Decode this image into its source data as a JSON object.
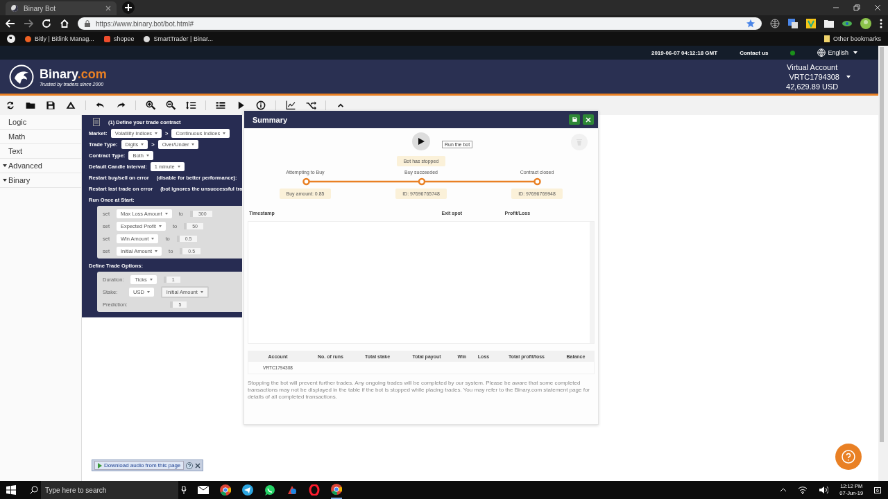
{
  "browser": {
    "tab_title": "Binary Bot",
    "url": "https://www.binary.bot/bot.html#",
    "bookmarks": [
      "Bitly | Bitlink Manag...",
      "shopee",
      "SmartTrader | Binar..."
    ],
    "other_bookmarks": "Other bookmarks"
  },
  "site_bar": {
    "datetime": "2019-06-07 04:12:18 GMT",
    "contact": "Contact us",
    "online": true,
    "language": "English"
  },
  "header": {
    "logo_name": "Binary",
    "logo_suffix": ".com",
    "tagline": "Trusted by traders since 2000",
    "account_type": "Virtual Account",
    "account_id": "VRTC1794308",
    "balance": "42,629.89 USD"
  },
  "toolbox": [
    {
      "label": "Logic",
      "expandable": false
    },
    {
      "label": "Math",
      "expandable": false
    },
    {
      "label": "Text",
      "expandable": false
    },
    {
      "label": "Advanced",
      "expandable": true
    },
    {
      "label": "Binary",
      "expandable": true
    }
  ],
  "block": {
    "title": "(1) Define your trade contract",
    "separator": ">",
    "rows": [
      {
        "kind": "dropdowns",
        "label": "Market:",
        "dropdowns": [
          "Volatility Indices",
          "Continuous Indices"
        ]
      },
      {
        "kind": "dropdowns",
        "label": "Trade Type:",
        "dropdowns": [
          "Digits",
          "Over/Under"
        ]
      },
      {
        "kind": "dropdowns",
        "label": "Contract Type:",
        "dropdowns": [
          "Both"
        ]
      },
      {
        "kind": "dropdowns",
        "label": "Default Candle Interval:",
        "dropdowns": [
          "1 minute"
        ]
      },
      {
        "kind": "note",
        "label": "Restart buy/sell on error",
        "note": "(disable for better performance):"
      },
      {
        "kind": "note",
        "label": "Restart last trade on error",
        "note": "(bot ignores the unsuccessful tra"
      }
    ],
    "run_once_label": "Run Once at Start:",
    "set_rows": [
      {
        "keyword": "set",
        "variable": "Max Loss Amount",
        "connector": "to",
        "value": "300"
      },
      {
        "keyword": "set",
        "variable": "Expected Profit",
        "connector": "to",
        "value": "50"
      },
      {
        "keyword": "set",
        "variable": "Win Amount",
        "connector": "to",
        "value": "0.5"
      },
      {
        "keyword": "set",
        "variable": "Initial Amount",
        "connector": "to",
        "value": "0.5"
      }
    ],
    "trade_options_label": "Define Trade Options:",
    "options": [
      {
        "kind": "duration",
        "label": "Duration:",
        "dropdown": "Ticks",
        "value": "1"
      },
      {
        "kind": "stake",
        "label": "Stake:",
        "dropdown": "USD",
        "value_dropdown": "Initial Amount"
      },
      {
        "kind": "prediction",
        "label": "Prediction:",
        "value": "5"
      }
    ]
  },
  "summary": {
    "title": "Summary",
    "tooltip": "Run the bot",
    "status": "Bot has stopped",
    "steps": [
      {
        "label": "Attempting to Buy",
        "detail": "Buy amount: 0.85"
      },
      {
        "label": "Buy succeeded",
        "detail": "ID: 97696765748"
      },
      {
        "label": "Contract closed",
        "detail": "ID: 97696769948"
      }
    ],
    "columns": [
      "Timestamp",
      "Exit spot",
      "Profit/Loss"
    ],
    "stats_columns": [
      "Account",
      "No. of runs",
      "Total stake",
      "Total payout",
      "Win",
      "Loss",
      "Total profit/loss",
      "Balance"
    ],
    "stats_row": [
      "VRTC1794308"
    ],
    "notice": "Stopping the bot will prevent further trades. Any ongoing trades will be completed by our system. Please be aware that some completed transactions may not be displayed in the table if the bot is stopped while placing trades. You may refer to the Binary.com statement page for details of all completed transactions."
  },
  "download_bar": {
    "label": "Download audio from this page"
  },
  "taskbar": {
    "search_placeholder": "Type here to search",
    "time": "12:12 PM",
    "date": "07-Jun-19",
    "notifications": "6"
  }
}
